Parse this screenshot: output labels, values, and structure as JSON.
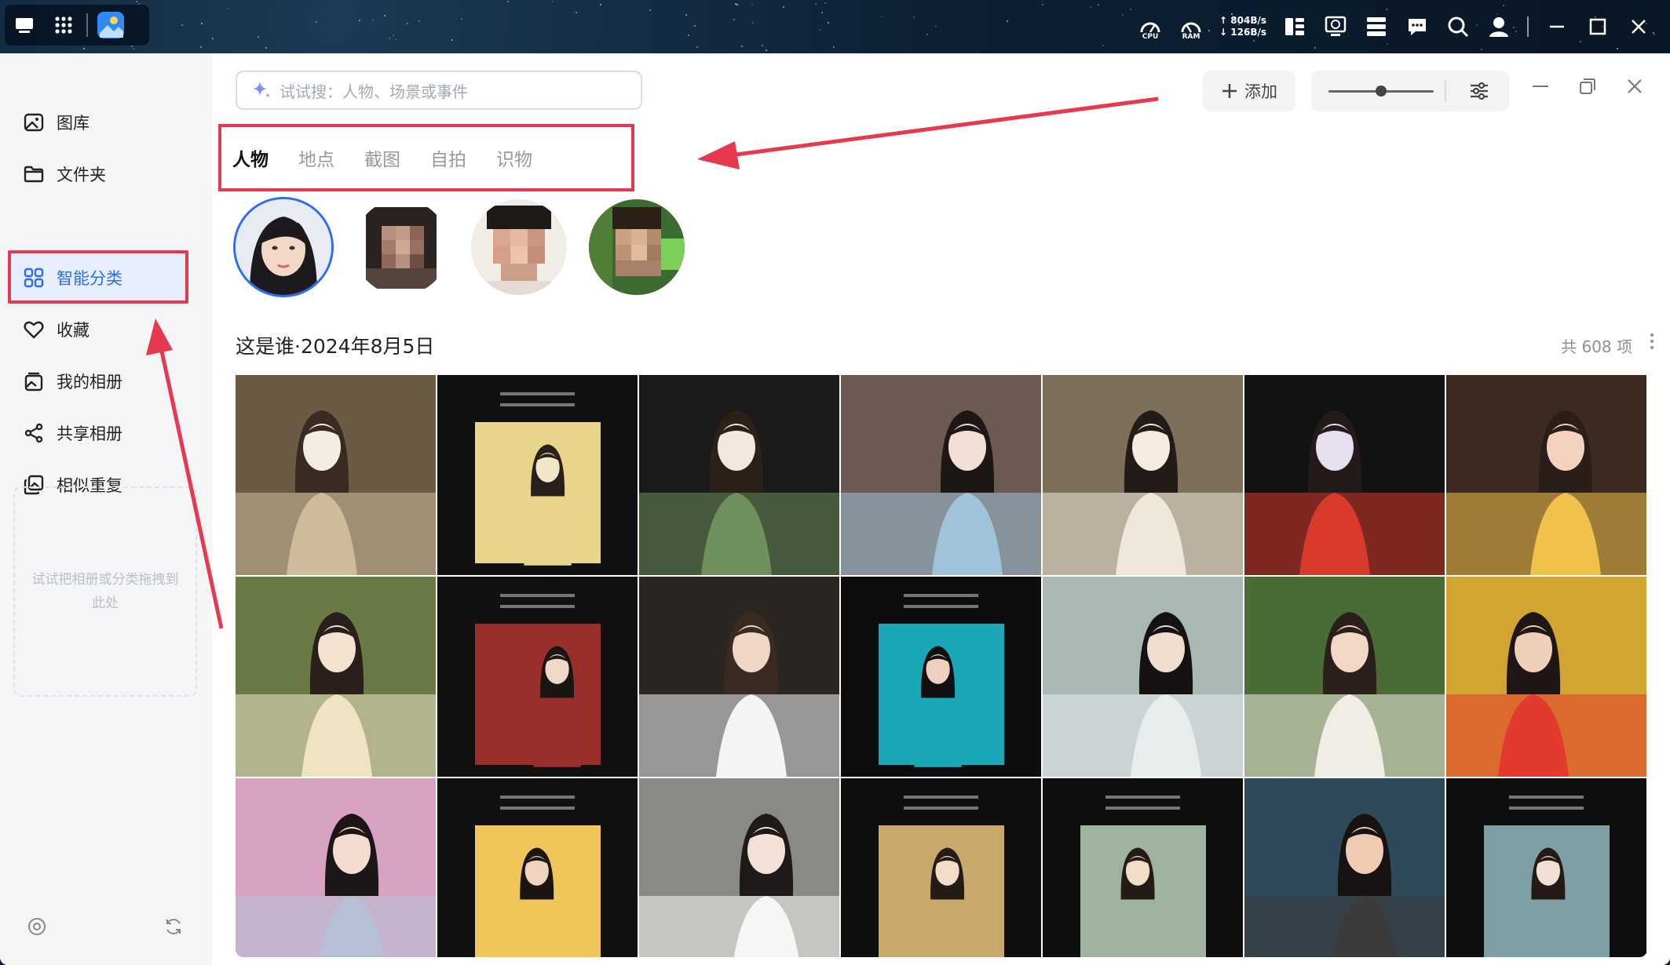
{
  "system_bar": {
    "cpu_label": "CPU",
    "ram_label": "RAM",
    "upload_speed": "↑ 804B/s",
    "download_speed": "↓ 126B/s"
  },
  "sidebar": {
    "items": [
      {
        "label": "图库",
        "icon": "gallery-icon"
      },
      {
        "label": "文件夹",
        "icon": "folder-icon"
      },
      {
        "label": "智能分类",
        "icon": "smart-category-icon",
        "active": true
      },
      {
        "label": "收藏",
        "icon": "heart-icon"
      },
      {
        "label": "我的相册",
        "icon": "album-icon"
      },
      {
        "label": "共享相册",
        "icon": "share-icon"
      },
      {
        "label": "相似重复",
        "icon": "duplicate-icon"
      }
    ],
    "drop_hint": "试试把相册或分类拖拽到此处"
  },
  "toolbar": {
    "search_placeholder": "试试搜：人物、场景或事件",
    "add_label": "添加",
    "zoom_level": 0.5
  },
  "tabs": [
    {
      "label": "人物",
      "active": true
    },
    {
      "label": "地点"
    },
    {
      "label": "截图"
    },
    {
      "label": "自拍"
    },
    {
      "label": "识物"
    }
  ],
  "section": {
    "title": "这是谁·2024年8月5日",
    "count": "共 608 项"
  },
  "colors": {
    "accent": "#2d6cf4",
    "annotation": "#e6384f"
  }
}
